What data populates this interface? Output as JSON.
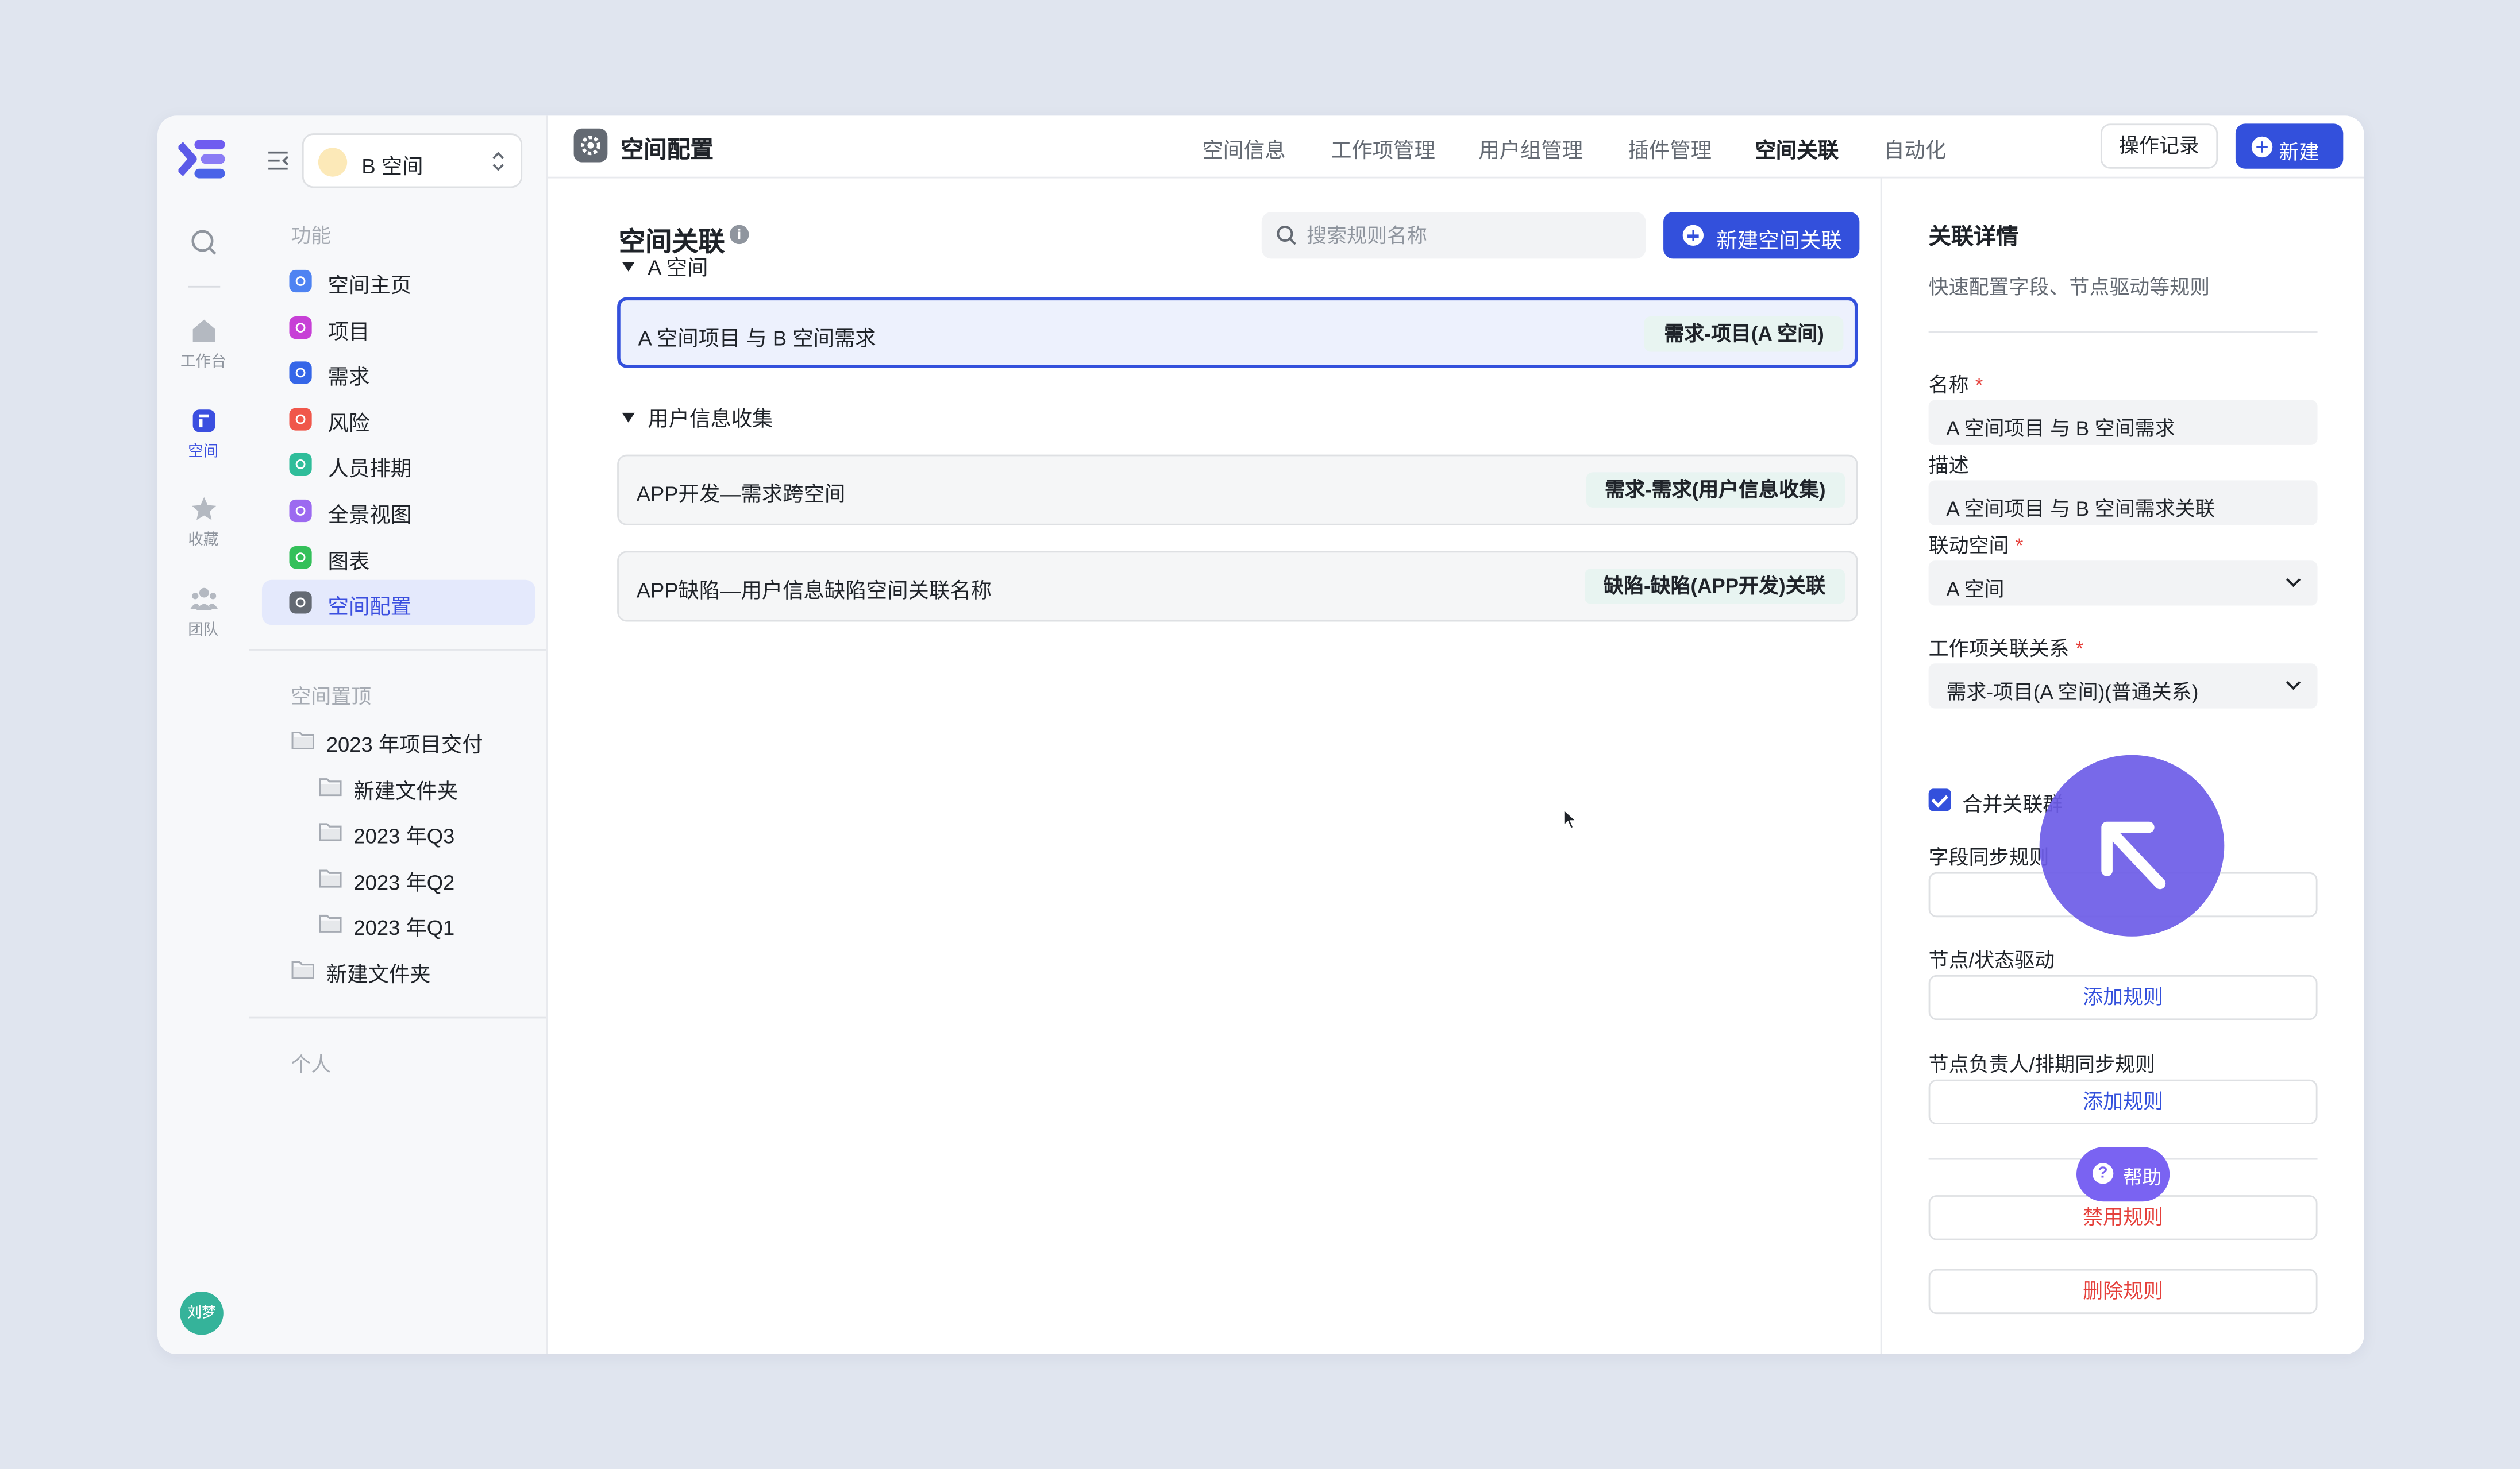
{
  "rail": {
    "items": [
      {
        "label": "",
        "icon": "search-icon"
      },
      {
        "label": "工作台",
        "icon": "home-icon"
      },
      {
        "label": "空间",
        "icon": "space-icon"
      },
      {
        "label": "收藏",
        "icon": "star-icon"
      },
      {
        "label": "团队",
        "icon": "team-icon"
      }
    ],
    "avatar": "刘梦"
  },
  "sidebar": {
    "space_name": "B 空间",
    "section_features": "功能",
    "nav": [
      {
        "label": "空间主页",
        "color": "#4e83f2"
      },
      {
        "label": "项目",
        "color": "#c740d6"
      },
      {
        "label": "需求",
        "color": "#3566e8"
      },
      {
        "label": "风险",
        "color": "#f0574b"
      },
      {
        "label": "人员排期",
        "color": "#2fbd9a"
      },
      {
        "label": "全景视图",
        "color": "#9c6af0"
      },
      {
        "label": "图表",
        "color": "#34c05a"
      },
      {
        "label": "空间配置",
        "color": "#646a73"
      }
    ],
    "section_pinned": "空间置顶",
    "folders": [
      {
        "label": "2023 年项目交付"
      },
      {
        "label": "新建文件夹"
      },
      {
        "label": "2023 年Q3"
      },
      {
        "label": "2023 年Q2"
      },
      {
        "label": "2023 年Q1"
      },
      {
        "label": "新建文件夹"
      }
    ],
    "section_personal": "个人"
  },
  "topbar": {
    "title": "空间配置",
    "tabs": [
      "空间信息",
      "工作项管理",
      "用户组管理",
      "插件管理",
      "空间关联",
      "自动化"
    ],
    "active_tab": "空间关联",
    "log_label": "操作记录",
    "new_label": "新建"
  },
  "main": {
    "title": "空间关联",
    "search_placeholder": "搜索规则名称",
    "new_assoc_label": "新建空间关联",
    "groups": [
      {
        "name": "A 空间",
        "rules": [
          {
            "name": "A 空间项目 与 B 空间需求",
            "tag": "需求-项目(A 空间)",
            "selected": true
          }
        ]
      },
      {
        "name": "用户信息收集",
        "rules": [
          {
            "name": "APP开发—需求跨空间",
            "tag": "需求-需求(用户信息收集)"
          },
          {
            "name": "APP缺陷—用户信息缺陷空间关联名称",
            "tag": "缺陷-缺陷(APP开发)关联"
          }
        ]
      }
    ]
  },
  "detail": {
    "title": "关联详情",
    "subtitle": "快速配置字段、节点驱动等规则",
    "name_label": "名称",
    "name_value": "A 空间项目 与 B 空间需求",
    "desc_label": "描述",
    "desc_value": "A 空间项目 与 B 空间需求关联",
    "linked_space_label": "联动空间",
    "linked_space_value": "A 空间",
    "relation_label": "工作项关联关系",
    "relation_value": "需求-项目(A 空间)(普通关系)",
    "merge_label": "合并关联群",
    "field_sync_label": "字段同步规则",
    "node_drive_label": "节点/状态驱动",
    "add_rule_1": "添加规则",
    "owner_sync_label": "节点负责人/排期同步规则",
    "add_rule_2": "添加规则",
    "disable_label": "禁用规则",
    "delete_label": "删除规则"
  },
  "help_label": "帮助",
  "colors": {
    "accent": "#3350dc",
    "danger": "#e5403b",
    "help": "#7a63f2"
  }
}
